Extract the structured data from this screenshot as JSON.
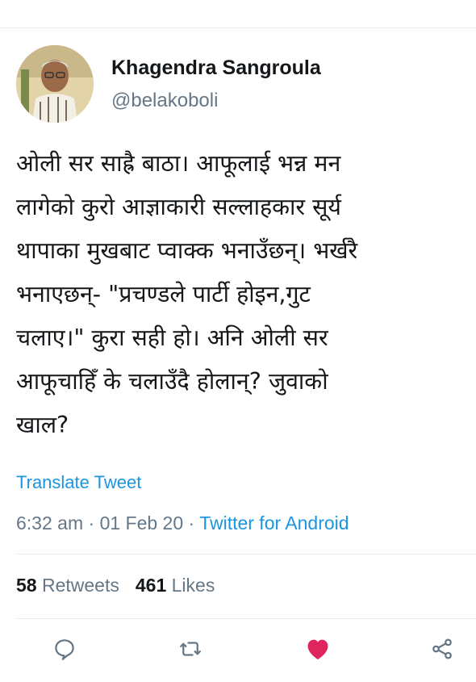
{
  "tweet": {
    "author": {
      "name": "Khagendra Sangroula",
      "handle": "@belakoboli"
    },
    "text_lines": [
      "ओली सर साह्रै बाठा। आफूलाई भन्न मन",
      "लागेको कुरो आज्ञाकारी सल्लाहकार सूर्य",
      "थापाका मुखबाट प्वाक्क भनाउँछन्। भर्खरै",
      "भनाएछन्- \"प्रचण्डले पार्टी होइन,गुट",
      "चलाए।\" कुरा सही हो। अनि ओली सर",
      "आफूचाहिँ के चलाउँदै होलान्? जुवाको",
      "खाल?"
    ],
    "translate_label": "Translate Tweet",
    "time": "6:32 am",
    "date": "01 Feb 20",
    "separator": " · ",
    "source": "Twitter for Android",
    "retweets_count": "58",
    "retweets_label": "Retweets",
    "likes_count": "461",
    "likes_label": "Likes"
  },
  "actions": {
    "reply_icon": "reply-bubble-icon",
    "retweet_icon": "retweet-arrows-icon",
    "like_icon": "heart-icon",
    "share_icon": "share-icon"
  },
  "colors": {
    "link": "#1b95e0",
    "secondary_text": "#657786",
    "like_active": "#e0245e",
    "divider": "#e6ecf0"
  }
}
